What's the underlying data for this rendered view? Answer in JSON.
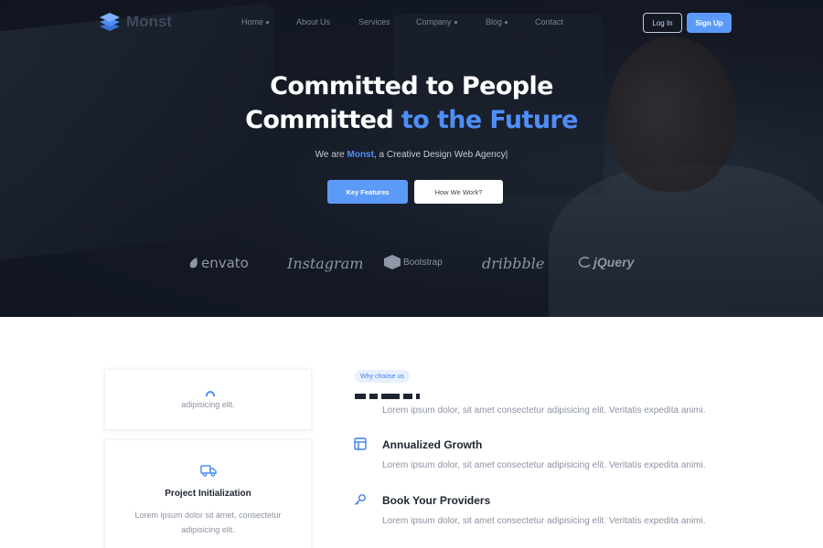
{
  "nav": {
    "logo_text": "Monst",
    "items": [
      {
        "label": "Home",
        "dropdown": true
      },
      {
        "label": "About Us",
        "dropdown": false
      },
      {
        "label": "Services",
        "dropdown": false
      },
      {
        "label": "Company",
        "dropdown": true
      },
      {
        "label": "Blog",
        "dropdown": true
      },
      {
        "label": "Contact",
        "dropdown": false
      }
    ],
    "login_label": "Log In",
    "signup_label": "Sign Up"
  },
  "hero": {
    "line1": "Committed to People",
    "line2_prefix": "Committed",
    "line2_accent": "to the Future",
    "tagline_prefix": "We are",
    "tagline_brand": "Monst",
    "tagline_suffix": ", a Creative Design Web Agency|",
    "primary_button": "Key Features",
    "secondary_button": "How We Work?",
    "brands": [
      "envato",
      "Instagram",
      "Bootstrap",
      "dribbble",
      "jQuery"
    ]
  },
  "cards": {
    "card1_text": "adipisicing elit.",
    "card2_title": "Project Initialization",
    "card2_text_line1": "Lorem ipsum dolor sit amet, consectetur",
    "card2_text_line2": "adipisicing elit."
  },
  "why": {
    "badge": "Why choose us",
    "feature_text": "Lorem ipsum dolor, sit amet consectetur adipisicing elit. Veritatis expedita animi.",
    "features": [
      {
        "title": "Annualized Growth",
        "icon": "bar-chart-icon"
      },
      {
        "title": "Book Your Providers",
        "icon": "key-icon"
      }
    ]
  },
  "colors": {
    "accent": "#4f8ef7",
    "button_blue": "#5b9bf7",
    "heading_dark": "#1d2532",
    "body_gray": "#8b93a1"
  }
}
